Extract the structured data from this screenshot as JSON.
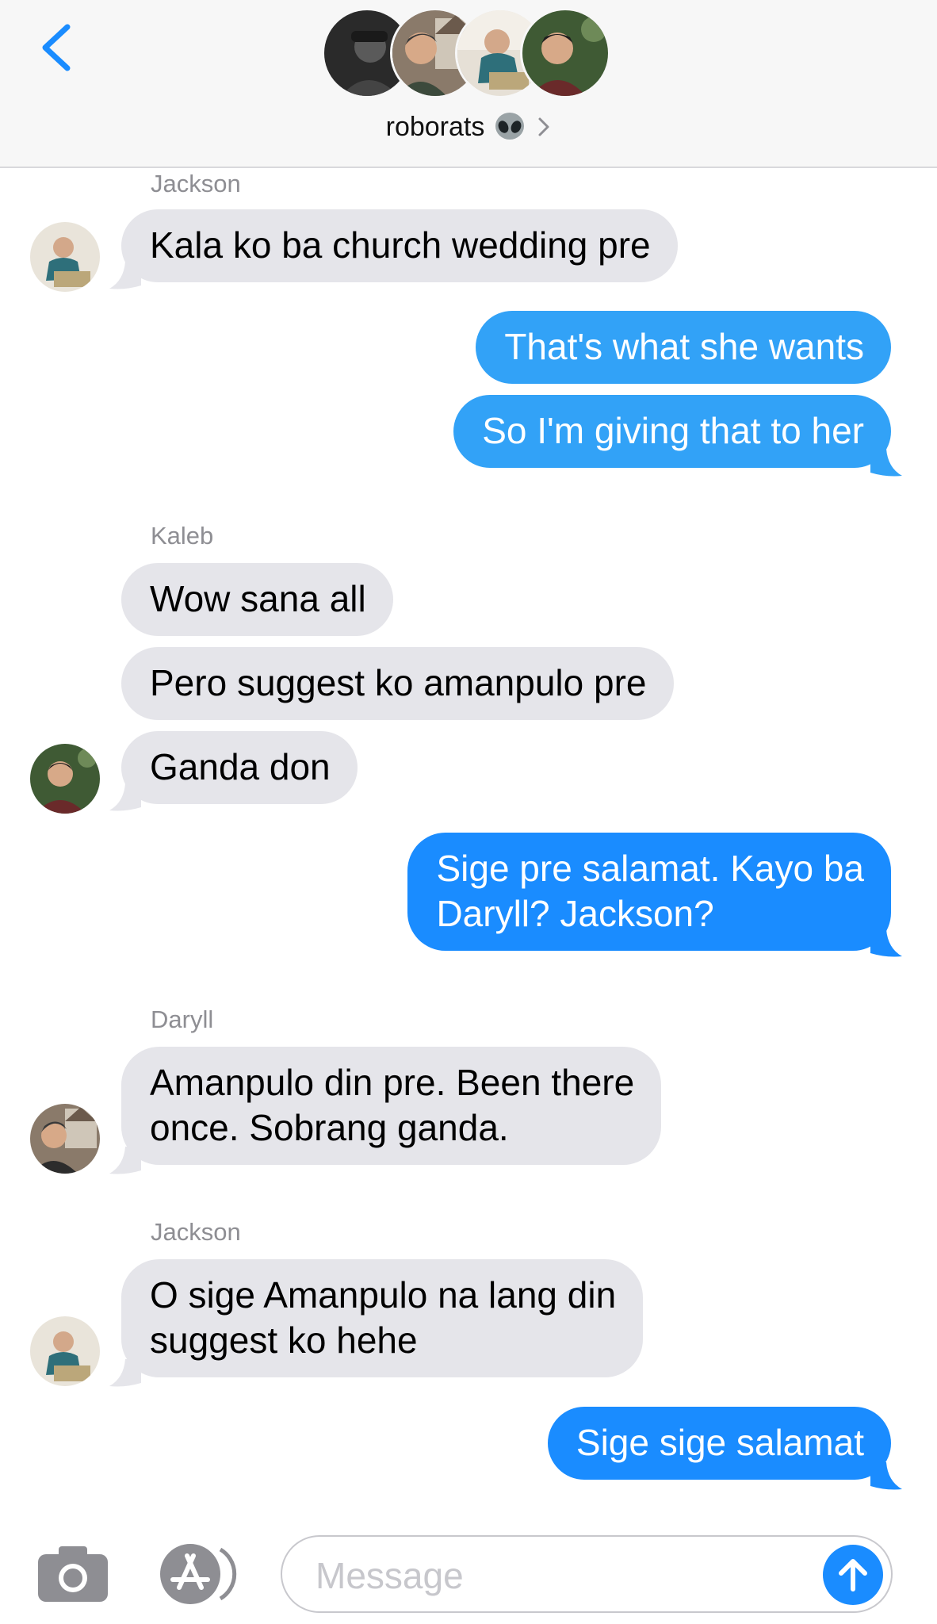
{
  "header": {
    "group_name": "roborats",
    "group_emoji_icon": "alien-icon",
    "back_icon": "chevron-left-icon",
    "accent": "#1a8cff"
  },
  "messages": [
    {
      "sender": "Jackson",
      "direction": "incoming",
      "text": "Kala ko ba church wedding pre"
    },
    {
      "direction": "outgoing",
      "text": "That's what she wants"
    },
    {
      "direction": "outgoing",
      "text": "So I'm giving that to her"
    },
    {
      "sender": "Kaleb",
      "direction": "incoming",
      "text": "Wow sana all"
    },
    {
      "direction": "incoming",
      "text": "Pero suggest ko amanpulo pre"
    },
    {
      "direction": "incoming",
      "text": "Ganda don"
    },
    {
      "direction": "outgoing",
      "text": "Sige pre salamat. Kayo ba\nDaryll? Jackson?"
    },
    {
      "sender": "Daryll",
      "direction": "incoming",
      "text": "Amanpulo din pre. Been there\nonce. Sobrang ganda."
    },
    {
      "sender": "Jackson",
      "direction": "incoming",
      "text": "O sige Amanpulo na lang din\nsuggest ko hehe"
    },
    {
      "direction": "outgoing",
      "text": "Sige sige salamat"
    }
  ],
  "input": {
    "placeholder": "Message",
    "camera_icon": "camera-icon",
    "apps_icon": "app-store-icon",
    "send_icon": "send-arrow-icon"
  },
  "colors": {
    "incoming_bubble": "#e5e5ea",
    "outgoing_bubble": "#1a8cff",
    "meta_text": "#8e8e93"
  }
}
